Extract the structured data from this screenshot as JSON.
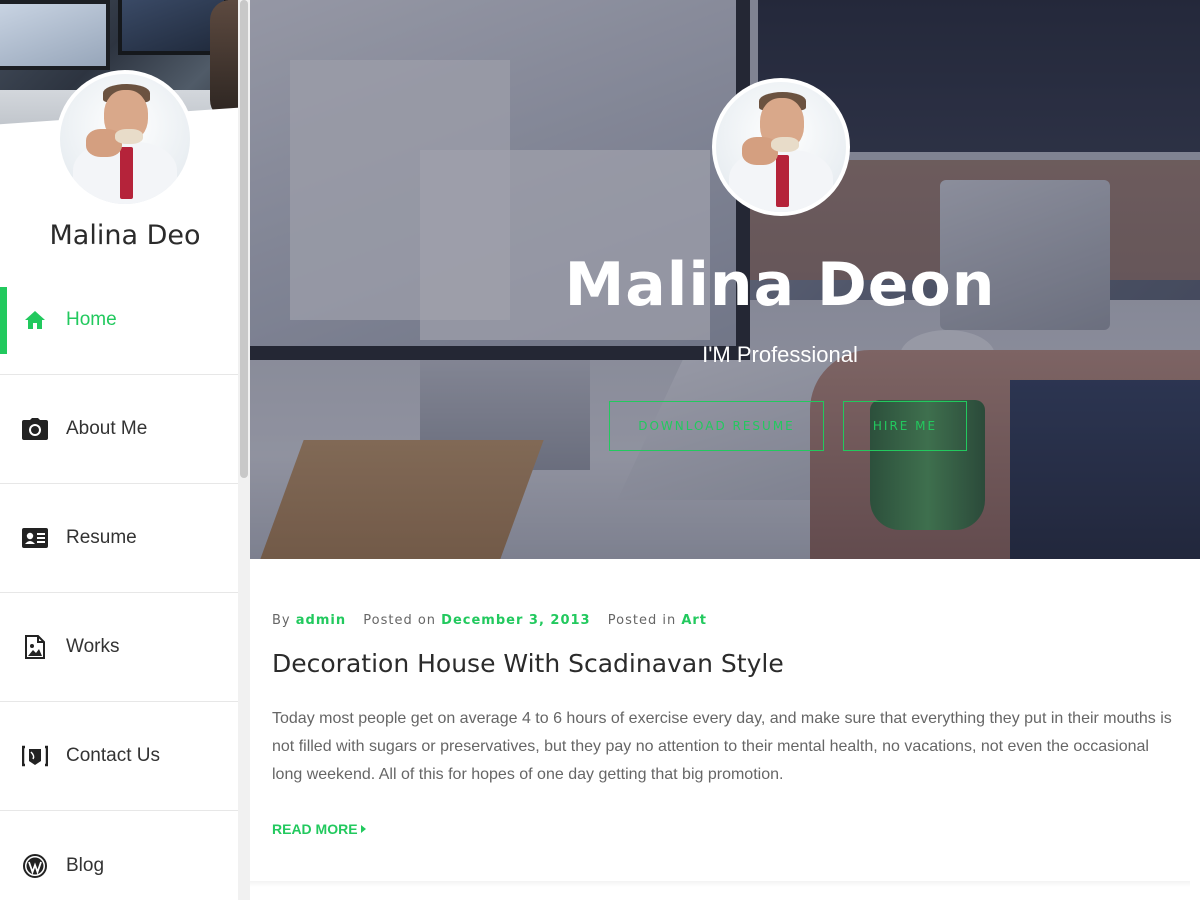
{
  "sidebar": {
    "name": "Malina Deo",
    "nav": [
      {
        "label": "Home",
        "icon": "home-icon",
        "active": true
      },
      {
        "label": "About Me",
        "icon": "camera-icon",
        "active": false
      },
      {
        "label": "Resume",
        "icon": "id-card-icon",
        "active": false
      },
      {
        "label": "Works",
        "icon": "image-file-icon",
        "active": false
      },
      {
        "label": "Contact Us",
        "icon": "contact-icon",
        "active": false
      },
      {
        "label": "Blog",
        "icon": "wordpress-icon",
        "active": false
      }
    ]
  },
  "hero": {
    "title": "Malina Deon",
    "subtitle": "I'M Professional",
    "download_label": "DOWNLOAD RESUME",
    "hire_label": "HIRE ME"
  },
  "post": {
    "by_label": "By",
    "author": "admin",
    "posted_on_label": "Posted on",
    "date": "December 3, 2013",
    "posted_in_label": "Posted in",
    "category": "Art",
    "title": "Decoration House With Scadinavan Style",
    "excerpt": "Today most people get on average 4 to 6 hours of exercise every day, and make sure that everything they put in their mouths is not filled with sugars or preservatives, but they pay no attention to their mental health, no vacations, not even the occasional long weekend. All of this for hopes of one day getting that big promotion.",
    "read_more": "READ MORE"
  },
  "colors": {
    "accent": "#22c95e",
    "text_dark": "#2b2b2b",
    "text_muted": "#666666"
  }
}
